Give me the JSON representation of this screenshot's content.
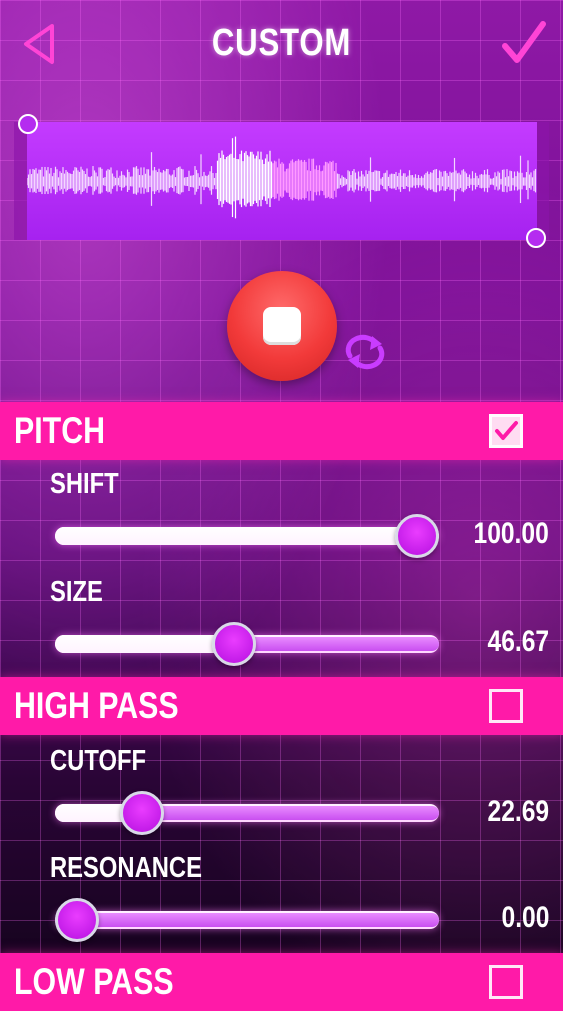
{
  "header": {
    "title": "CUSTOM"
  },
  "sections": [
    {
      "title": "PITCH",
      "checked": true,
      "params": [
        {
          "label": "SHIFT",
          "value": "100.00",
          "fraction": 1.0
        },
        {
          "label": "SIZE",
          "value": "46.67",
          "fraction": 0.467
        }
      ]
    },
    {
      "title": "HIGH PASS",
      "checked": false,
      "params": [
        {
          "label": "CUTOFF",
          "value": "22.69",
          "fraction": 0.227
        },
        {
          "label": "RESONANCE",
          "value": "0.00",
          "fraction": 0.0
        }
      ]
    },
    {
      "title": "LOW PASS",
      "checked": false,
      "params": []
    }
  ],
  "colors": {
    "section_header": "#ff1aa8",
    "waveform_bg": "#b52cf0",
    "stop_button": "#f23a3a"
  },
  "icons": {
    "back": "triangle-left-icon",
    "confirm": "checkmark-icon",
    "stop": "stop-square-icon",
    "loop": "loop-arrows-icon"
  }
}
